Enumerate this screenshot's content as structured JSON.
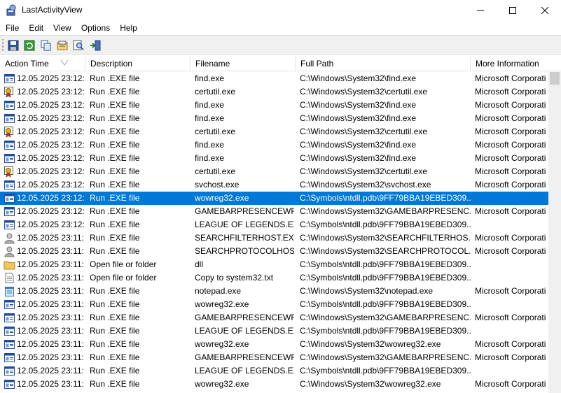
{
  "window": {
    "title": "LastActivityView",
    "controls": {
      "minimize": "—",
      "maximize": "☐",
      "close": "✕"
    }
  },
  "menu": [
    "File",
    "Edit",
    "View",
    "Options",
    "Help"
  ],
  "toolbar": {
    "buttons": [
      "save-icon",
      "refresh-icon",
      "copy-icon",
      "properties-icon",
      "find-icon",
      "exit-icon"
    ]
  },
  "columns": [
    "Action Time",
    "Description",
    "Filename",
    "Full Path",
    "More Information"
  ],
  "rows": [
    {
      "icon": "exe",
      "time": "12.05.2025 23:12:...",
      "desc": "Run .EXE file",
      "file": "find.exe",
      "path": "C:\\Windows\\System32\\find.exe",
      "info": "Microsoft Corporati"
    },
    {
      "icon": "cert",
      "time": "12.05.2025 23:12:...",
      "desc": "Run .EXE file",
      "file": "certutil.exe",
      "path": "C:\\Windows\\System32\\certutil.exe",
      "info": "Microsoft Corporati"
    },
    {
      "icon": "exe",
      "time": "12.05.2025 23:12:...",
      "desc": "Run .EXE file",
      "file": "find.exe",
      "path": "C:\\Windows\\System32\\find.exe",
      "info": "Microsoft Corporati"
    },
    {
      "icon": "exe",
      "time": "12.05.2025 23:12:...",
      "desc": "Run .EXE file",
      "file": "find.exe",
      "path": "C:\\Windows\\System32\\find.exe",
      "info": "Microsoft Corporati"
    },
    {
      "icon": "cert",
      "time": "12.05.2025 23:12:...",
      "desc": "Run .EXE file",
      "file": "certutil.exe",
      "path": "C:\\Windows\\System32\\certutil.exe",
      "info": "Microsoft Corporati"
    },
    {
      "icon": "exe",
      "time": "12.05.2025 23:12:...",
      "desc": "Run .EXE file",
      "file": "find.exe",
      "path": "C:\\Windows\\System32\\find.exe",
      "info": "Microsoft Corporati"
    },
    {
      "icon": "exe",
      "time": "12.05.2025 23:12:...",
      "desc": "Run .EXE file",
      "file": "find.exe",
      "path": "C:\\Windows\\System32\\find.exe",
      "info": "Microsoft Corporati"
    },
    {
      "icon": "cert",
      "time": "12.05.2025 23:12:...",
      "desc": "Run .EXE file",
      "file": "certutil.exe",
      "path": "C:\\Windows\\System32\\certutil.exe",
      "info": "Microsoft Corporati"
    },
    {
      "icon": "exe",
      "time": "12.05.2025 23:12:...",
      "desc": "Run .EXE file",
      "file": "svchost.exe",
      "path": "C:\\Windows\\System32\\svchost.exe",
      "info": "Microsoft Corporati"
    },
    {
      "icon": "exe",
      "time": "12.05.2025 23:12:...",
      "desc": "Run .EXE file",
      "file": "wowreg32.exe",
      "path": "C:\\Symbols\\ntdll.pdb\\9FF79BBA19EBED309...",
      "info": "",
      "selected": true
    },
    {
      "icon": "exe",
      "time": "12.05.2025 23:12:...",
      "desc": "Run .EXE file",
      "file": "GAMEBARPRESENCEWR...",
      "path": "C:\\Windows\\System32\\GAMEBARPRESENC...",
      "info": "Microsoft Corporati"
    },
    {
      "icon": "exe",
      "time": "12.05.2025 23:12:...",
      "desc": "Run .EXE file",
      "file": "LEAGUE OF LEGENDS.EXE",
      "path": "C:\\Symbols\\ntdll.pdb\\9FF79BBA19EBED309...",
      "info": ""
    },
    {
      "icon": "user",
      "time": "12.05.2025 23:11:...",
      "desc": "Run .EXE file",
      "file": "SEARCHFILTERHOST.EXE",
      "path": "C:\\Windows\\System32\\SEARCHFILTERHOS...",
      "info": "Microsoft Corporati"
    },
    {
      "icon": "user",
      "time": "12.05.2025 23:11:...",
      "desc": "Run .EXE file",
      "file": "SEARCHPROTOCOLHOS...",
      "path": "C:\\Windows\\System32\\SEARCHPROTOCOL...",
      "info": "Microsoft Corporati"
    },
    {
      "icon": "folder",
      "time": "12.05.2025 23:11:...",
      "desc": "Open file or folder",
      "file": "dll",
      "path": "C:\\Symbols\\ntdll.pdb\\9FF79BBA19EBED309...",
      "info": ""
    },
    {
      "icon": "doc",
      "time": "12.05.2025 23:11:...",
      "desc": "Open file or folder",
      "file": "Copy to system32.txt",
      "path": "C:\\Symbols\\ntdll.pdb\\9FF79BBA19EBED309...",
      "info": ""
    },
    {
      "icon": "notepad",
      "time": "12.05.2025 23:11:...",
      "desc": "Run .EXE file",
      "file": "notepad.exe",
      "path": "C:\\Windows\\System32\\notepad.exe",
      "info": "Microsoft Corporati"
    },
    {
      "icon": "exe",
      "time": "12.05.2025 23:11:...",
      "desc": "Run .EXE file",
      "file": "wowreg32.exe",
      "path": "C:\\Symbols\\ntdll.pdb\\9FF79BBA19EBED309...",
      "info": ""
    },
    {
      "icon": "exe",
      "time": "12.05.2025 23:11:...",
      "desc": "Run .EXE file",
      "file": "GAMEBARPRESENCEWR...",
      "path": "C:\\Windows\\System32\\GAMEBARPRESENC...",
      "info": "Microsoft Corporati"
    },
    {
      "icon": "exe",
      "time": "12.05.2025 23:11:...",
      "desc": "Run .EXE file",
      "file": "LEAGUE OF LEGENDS.EXE",
      "path": "C:\\Symbols\\ntdll.pdb\\9FF79BBA19EBED309...",
      "info": ""
    },
    {
      "icon": "exe",
      "time": "12.05.2025 23:11:...",
      "desc": "Run .EXE file",
      "file": "wowreg32.exe",
      "path": "C:\\Windows\\System32\\wowreg32.exe",
      "info": "Microsoft Corporati"
    },
    {
      "icon": "exe",
      "time": "12.05.2025 23:11:...",
      "desc": "Run .EXE file",
      "file": "GAMEBARPRESENCEWR...",
      "path": "C:\\Windows\\System32\\GAMEBARPRESENC...",
      "info": "Microsoft Corporati"
    },
    {
      "icon": "exe",
      "time": "12.05.2025 23:11:...",
      "desc": "Run .EXE file",
      "file": "LEAGUE OF LEGENDS.EXE",
      "path": "C:\\Symbols\\ntdll.pdb\\9FF79BBA19EBED309...",
      "info": ""
    },
    {
      "icon": "exe",
      "time": "12.05.2025 23:11:...",
      "desc": "Run .EXE file",
      "file": "wowreg32.exe",
      "path": "C:\\Windows\\System32\\wowreg32.exe",
      "info": "Microsoft Corporati"
    }
  ],
  "colors": {
    "selection": "#0078d7",
    "selection_text": "#ffffff",
    "grid_line": "#e5e5e5"
  }
}
